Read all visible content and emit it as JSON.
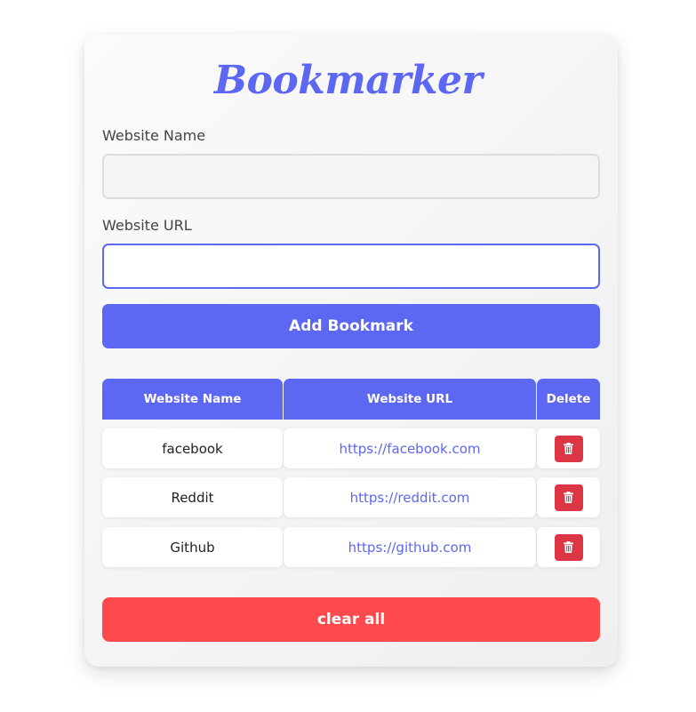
{
  "app": {
    "title": "Bookmarker",
    "accent_color": "#5c67f2",
    "danger_color": "#dc3545",
    "clear_color": "#ff4a4d"
  },
  "form": {
    "name_label": "Website Name",
    "name_value": "",
    "name_placeholder": "",
    "url_label": "Website URL",
    "url_value": "",
    "url_placeholder": "",
    "add_button": "Add Bookmark"
  },
  "table": {
    "headers": [
      "Website Name",
      "Website URL",
      "Delete"
    ],
    "rows": [
      {
        "name": "facebook",
        "url": "https://facebook.com",
        "delete_icon": "trash-icon"
      },
      {
        "name": "Reddit",
        "url": "https://reddit.com",
        "delete_icon": "trash-icon"
      },
      {
        "name": "Github",
        "url": "https://github.com",
        "delete_icon": "trash-icon"
      }
    ]
  },
  "footer": {
    "clear_button": "clear all"
  }
}
